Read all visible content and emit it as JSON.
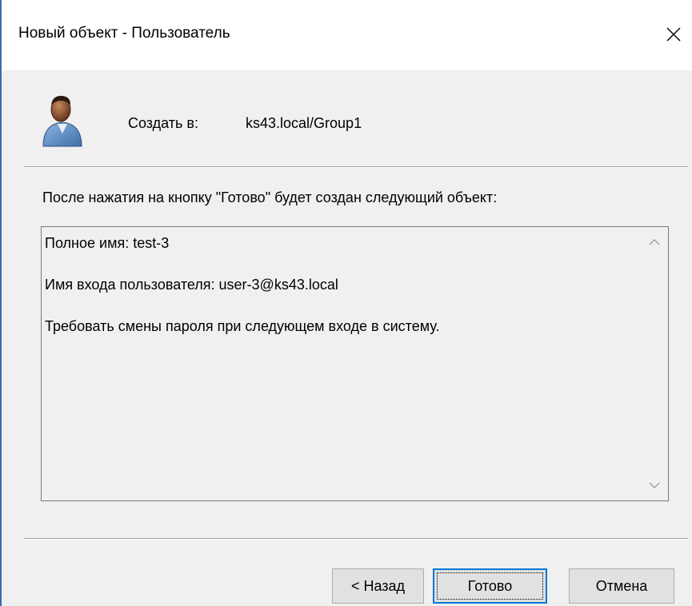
{
  "window": {
    "title": "Новый объект - Пользователь"
  },
  "header": {
    "create_label": "Создать в:",
    "create_value": "ks43.local/Group1"
  },
  "intro": "После нажатия на кнопку \"Готово\" будет создан следующий объект:",
  "summary": {
    "lines": [
      "Полное имя: test-3",
      "Имя входа пользователя: user-3@ks43.local",
      "Требовать смены пароля при следующем входе в систему."
    ]
  },
  "buttons": {
    "back": "< Назад",
    "finish": "Готово",
    "cancel": "Отмена"
  },
  "icons": {
    "close": "close-icon",
    "user": "user-icon",
    "scroll_up": "chevron-up-icon",
    "scroll_down": "chevron-down-icon"
  },
  "colors": {
    "accent": "#0078d7",
    "dialog_bg": "#f0f0f0",
    "titlebar_bg": "#ffffff"
  }
}
